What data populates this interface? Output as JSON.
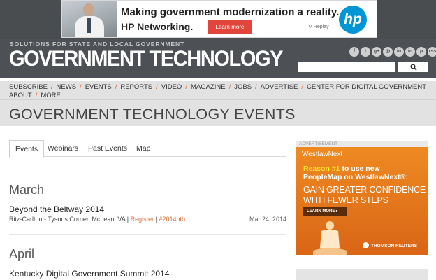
{
  "top_ad": {
    "line1": "Making government modernization a reality.",
    "line2": "HP Networking.",
    "cta": "Learn more",
    "replay": "↻ Replay",
    "brand": "hp"
  },
  "header": {
    "tagline": "SOLUTIONS FOR STATE AND LOCAL GOVERNMENT",
    "logo": "GOVERNMENT TECHNOLOGY",
    "social": [
      "f",
      "t",
      "g+",
      "◎",
      "in",
      "in",
      "p",
      "rss"
    ],
    "search_placeholder": "",
    "search_icon": "search-icon"
  },
  "nav": {
    "row1": [
      "SUBSCRIBE",
      "NEWS",
      "EVENTS",
      "REPORTS",
      "VIDEO",
      "MAGAZINE",
      "JOBS",
      "ADVERTISE",
      "CENTER FOR DIGITAL GOVERNMENT"
    ],
    "row2": [
      "ABOUT",
      "MORE"
    ],
    "active": "EVENTS"
  },
  "page_title": "GOVERNMENT TECHNOLOGY EVENTS",
  "tabs": [
    "Events",
    "Webinars",
    "Past Events",
    "Map"
  ],
  "months": [
    {
      "name": "March",
      "events": [
        {
          "title": "Beyond the Beltway 2014",
          "location": "Ritz-Carlton - Tysons Corner, McLean, VA",
          "sep": "|",
          "register": "Register",
          "hashtag": "#2014btb",
          "date": "Mar 24, 2014"
        }
      ]
    },
    {
      "name": "April",
      "events": [
        {
          "title": "Kentucky Digital Government Summit 2014"
        }
      ]
    }
  ],
  "side_ad": {
    "label": "ADVERTISEMENT",
    "brand": "WestlawNext",
    "reason_hi": "Reason #1",
    "reason_rest": " to use new",
    "reason_line2": "PeopleMap on WestlawNext®:",
    "gain1": "GAIN GREATER CONFIDENCE",
    "gain2": "WITH FEWER STEPS",
    "cta": "LEARN MORE ▸",
    "footer": "THOMSON REUTERS"
  },
  "colors": {
    "header_bg": "#4d5054",
    "nav_bg": "#e2e2e2",
    "accent": "#d8692a",
    "ad_orange": "#e67a1d"
  }
}
